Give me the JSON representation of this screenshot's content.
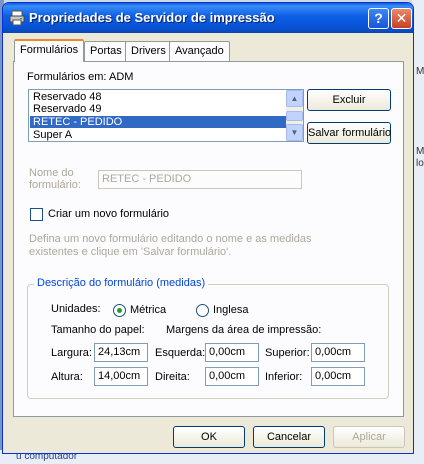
{
  "background": {
    "right_text_1": "M",
    "right_text_2": "Mi",
    "right_text_3": "lo",
    "bottom_text": "u computador"
  },
  "window": {
    "title": "Propriedades de Servidor de impressão",
    "help_label": "?",
    "close_label": "✕"
  },
  "tabs": [
    {
      "label": "Formulários"
    },
    {
      "label": "Portas"
    },
    {
      "label": "Drivers"
    },
    {
      "label": "Avançado"
    }
  ],
  "forms": {
    "server_label": "Formulários em:",
    "server_name": "ADM",
    "list_items": [
      "Reservado 48",
      "Reservado 49",
      "RETEC - PEDIDO",
      "Super A"
    ],
    "selected_index": 2,
    "delete_button": "Excluir",
    "save_button": "Salvar formulário",
    "form_name_label_1": "Nome do",
    "form_name_label_2": "formulário:",
    "form_name_value": "RETEC - PEDIDO",
    "create_new_label": "Criar um novo formulário",
    "create_new_checked": false,
    "hint_line_1": "Defina um novo formulário editando o nome e as medidas",
    "hint_line_2": "existentes e clique em 'Salvar formulário'."
  },
  "description": {
    "group_title": "Descrição do formulário (medidas)",
    "units_label": "Unidades:",
    "metric_label": "Métrica",
    "english_label": "Inglesa",
    "selected_unit": "Métrica",
    "paper_size_label": "Tamanho do papel:",
    "margins_label": "Margens da área de impressão:",
    "width_label": "Largura:",
    "width_value": "24,13cm",
    "height_label": "Altura:",
    "height_value": "14,00cm",
    "left_label": "Esquerda:",
    "left_value": "0,00cm",
    "right_label": "Direita:",
    "right_value": "0,00cm",
    "top_label": "Superior:",
    "top_value": "0,00cm",
    "bottom_label": "Inferior:",
    "bottom_value": "0,00cm"
  },
  "footer": {
    "ok": "OK",
    "cancel": "Cancelar",
    "apply": "Aplicar"
  }
}
